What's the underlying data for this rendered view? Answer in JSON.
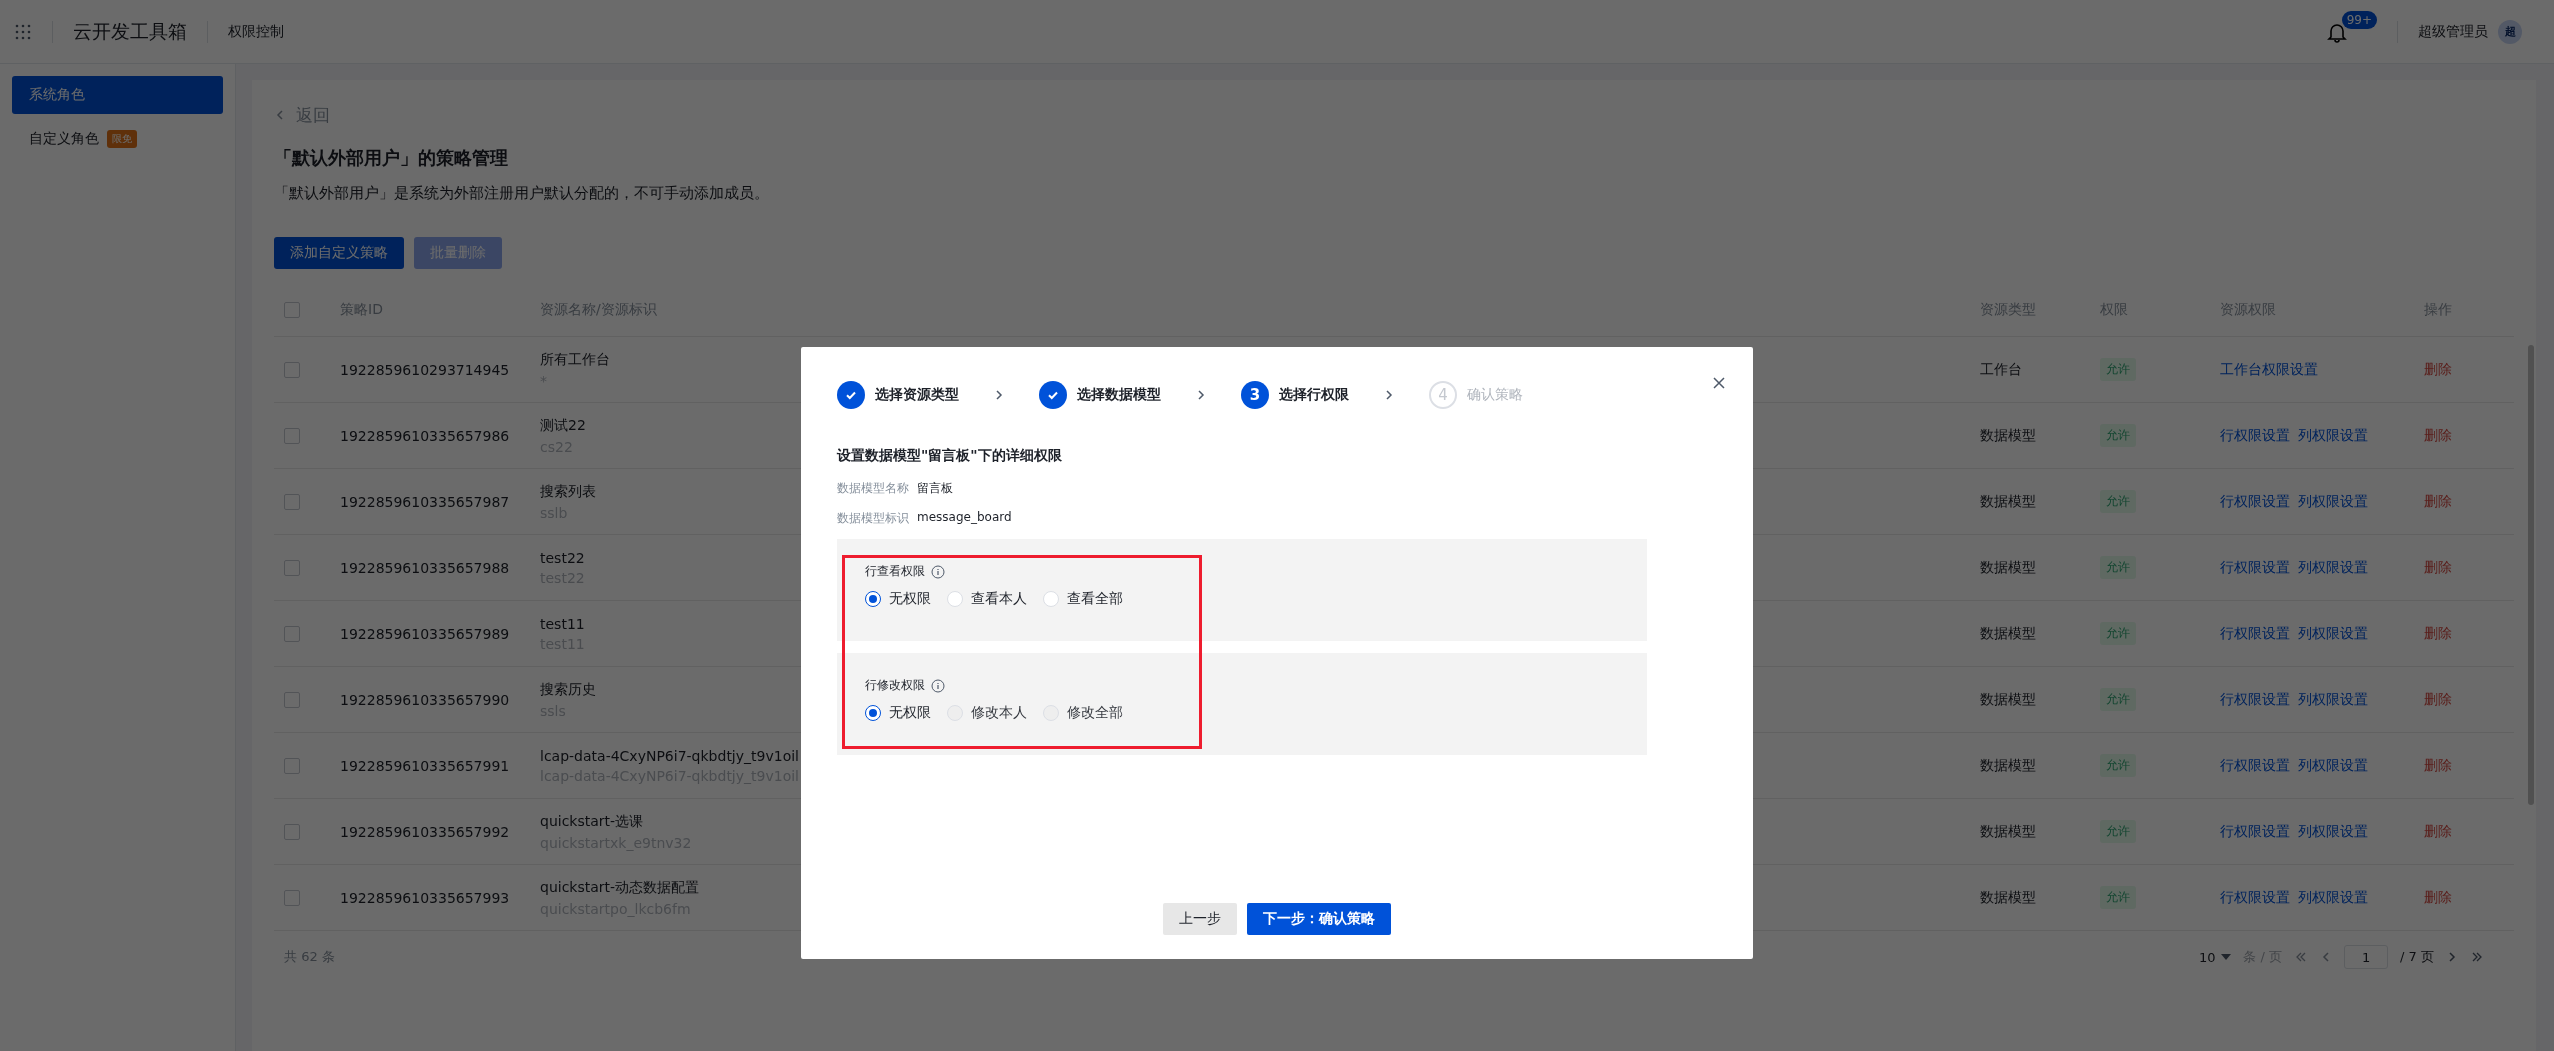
{
  "header": {
    "app_title": "云开发工具箱",
    "breadcrumb": "权限控制",
    "notification_count": "99+",
    "user_name": "超级管理员",
    "avatar_text": "超"
  },
  "sidebar": {
    "items": [
      {
        "label": "系统角色",
        "selected": true
      },
      {
        "label": "自定义角色",
        "selected": false,
        "badge": "限免"
      }
    ]
  },
  "page": {
    "back": "返回",
    "title": "「默认外部用户」的策略管理",
    "description": "「默认外部用户」是系统为外部注册用户默认分配的，不可手动添加成员。",
    "buttons": [
      {
        "label": "添加自定义策略",
        "disabled": false
      },
      {
        "label": "批量删除",
        "disabled": true
      }
    ]
  },
  "table": {
    "all_checked": false,
    "columns": [
      "策略ID",
      "资源名称/资源标识",
      "资源类型",
      "权限",
      "资源权限",
      "操作"
    ],
    "rows": [
      {
        "id": "1922859610293714945",
        "name": "所有工作台",
        "key": "*",
        "type": "工作台",
        "permission": "允许",
        "links": [
          "工作台权限设置"
        ],
        "action": "删除",
        "checked": false
      },
      {
        "id": "1922859610335657986",
        "name": "测试22",
        "key": "cs22",
        "type": "数据模型",
        "permission": "允许",
        "links": [
          "行权限设置",
          "列权限设置"
        ],
        "action": "删除",
        "checked": false
      },
      {
        "id": "1922859610335657987",
        "name": "搜索列表",
        "key": "sslb",
        "type": "数据模型",
        "permission": "允许",
        "links": [
          "行权限设置",
          "列权限设置"
        ],
        "action": "删除",
        "checked": false
      },
      {
        "id": "1922859610335657988",
        "name": "test22",
        "key": "test22",
        "type": "数据模型",
        "permission": "允许",
        "links": [
          "行权限设置",
          "列权限设置"
        ],
        "action": "删除",
        "checked": false
      },
      {
        "id": "1922859610335657989",
        "name": "test11",
        "key": "test11",
        "type": "数据模型",
        "permission": "允许",
        "links": [
          "行权限设置",
          "列权限设置"
        ],
        "action": "删除",
        "checked": false
      },
      {
        "id": "1922859610335657990",
        "name": "搜索历史",
        "key": "ssls",
        "type": "数据模型",
        "permission": "允许",
        "links": [
          "行权限设置",
          "列权限设置"
        ],
        "action": "删除",
        "checked": false
      },
      {
        "id": "1922859610335657991",
        "name": "lcap-data-4CxyNP6i7-qkbdtjy_t9v1oil",
        "key": "lcap-data-4CxyNP6i7-qkbdtjy_t9v1oil",
        "type": "数据模型",
        "permission": "允许",
        "links": [
          "行权限设置",
          "列权限设置"
        ],
        "action": "删除",
        "checked": false
      },
      {
        "id": "1922859610335657992",
        "name": "quickstart-选课",
        "key": "quickstartxk_e9tnv32",
        "type": "数据模型",
        "permission": "允许",
        "links": [
          "行权限设置",
          "列权限设置"
        ],
        "action": "删除",
        "checked": false
      },
      {
        "id": "1922859610335657993",
        "name": "quickstart-动态数据配置",
        "key": "quickstartpo_lkcb6fm",
        "type": "数据模型",
        "permission": "允许",
        "links": [
          "行权限设置",
          "列权限设置"
        ],
        "action": "删除",
        "checked": false
      }
    ],
    "total": "共 62 条",
    "pagination": {
      "page_size": "10",
      "page_unit": "条 / 页",
      "page": "1",
      "total_pages": "/ 7 页"
    }
  },
  "modal": {
    "steps": [
      {
        "label": "选择资源类型",
        "done": true,
        "active": true
      },
      {
        "label": "选择数据模型",
        "done": true,
        "active": true
      },
      {
        "number": "3",
        "label": "选择行权限",
        "done": false,
        "active": true
      },
      {
        "number": "4",
        "label": "确认策略",
        "done": false,
        "active": false
      }
    ],
    "heading": "设置数据模型\"留言板\"下的详细权限",
    "fields": [
      {
        "label": "数据模型名称",
        "value": "留言板"
      },
      {
        "label": "数据模型标识",
        "value": "message_board"
      }
    ],
    "highlighted": true,
    "groups": [
      {
        "label": "行查看权限",
        "options": [
          {
            "label": "无权限",
            "selected": true,
            "disabled": false
          },
          {
            "label": "查看本人",
            "selected": false,
            "disabled": false
          },
          {
            "label": "查看全部",
            "selected": false,
            "disabled": false
          }
        ]
      },
      {
        "label": "行修改权限",
        "options": [
          {
            "label": "无权限",
            "selected": true,
            "disabled": false
          },
          {
            "label": "修改本人",
            "selected": false,
            "disabled": true
          },
          {
            "label": "修改全部",
            "selected": false,
            "disabled": true
          }
        ]
      }
    ],
    "buttons": [
      {
        "label": "上一步",
        "kind": "secondary"
      },
      {
        "label": "下一步：确认策略",
        "kind": "primary"
      }
    ]
  }
}
